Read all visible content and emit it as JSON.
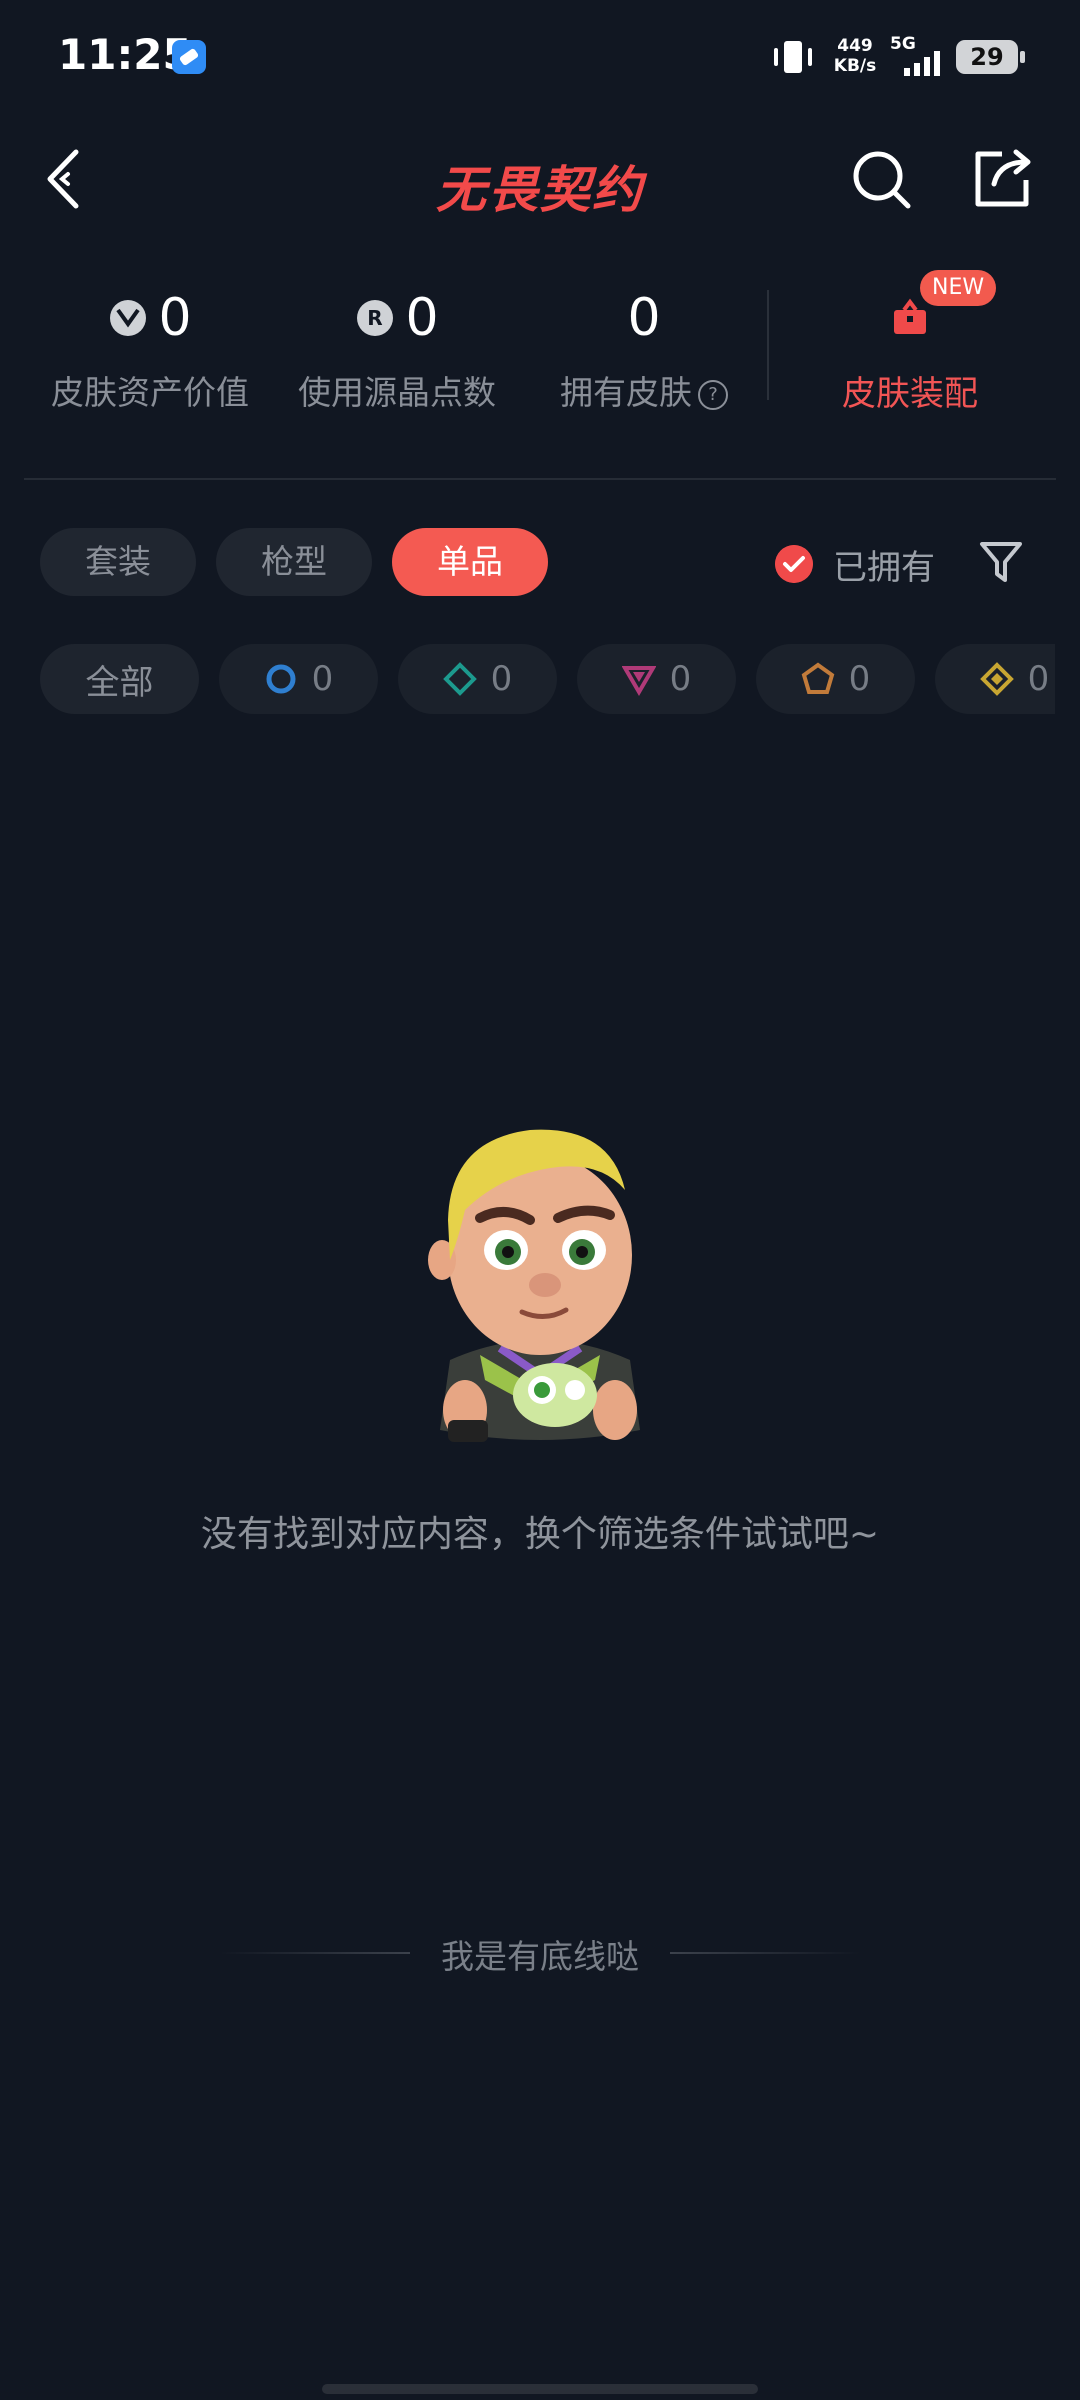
{
  "status_bar": {
    "time": "11:25",
    "net_speed_value": "449",
    "net_speed_unit": "KB/s",
    "network": "5G",
    "battery": "29"
  },
  "header": {
    "title": "无畏契约"
  },
  "stats": {
    "asset_value": {
      "value": "0",
      "label": "皮肤资产价值"
    },
    "radianite_points": {
      "value": "0",
      "label": "使用源晶点数"
    },
    "owned_skins": {
      "value": "0",
      "label": "拥有皮肤"
    },
    "skin_equip": {
      "badge": "NEW",
      "label": "皮肤装配"
    }
  },
  "type_tabs": [
    {
      "label": "套装",
      "active": false
    },
    {
      "label": "枪型",
      "active": false
    },
    {
      "label": "单品",
      "active": true
    }
  ],
  "owned_filter": {
    "label": "已拥有",
    "checked": true
  },
  "rarity_filters": {
    "all_label": "全部",
    "items": [
      {
        "icon": "circle-tier-icon",
        "color": "#2f7fd0",
        "count": "0"
      },
      {
        "icon": "diamond-tier-icon",
        "color": "#1c9a8e",
        "count": "0"
      },
      {
        "icon": "triangle-tier-icon",
        "color": "#b03a78",
        "count": "0"
      },
      {
        "icon": "pentagon-tier-icon",
        "color": "#c27b3a",
        "count": "0"
      },
      {
        "icon": "diamond-gold-tier-icon",
        "color": "#c8a632",
        "count": "0"
      }
    ]
  },
  "empty_state": {
    "message": "没有找到对应内容，换个筛选条件试试吧~"
  },
  "footer": {
    "bottom_line_text": "我是有底线哒"
  }
}
